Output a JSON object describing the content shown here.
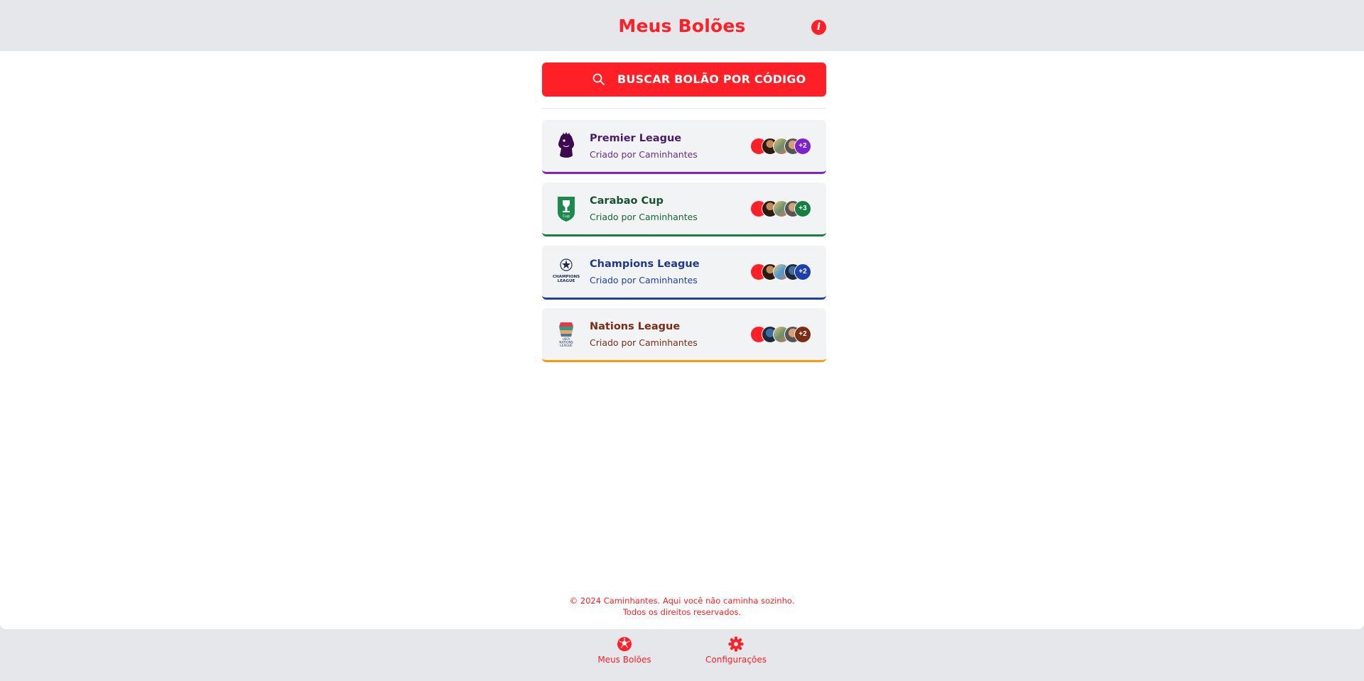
{
  "header": {
    "title": "Meus Bolões",
    "info_label": "i"
  },
  "search": {
    "label": "BUSCAR BOLÃO POR CÓDIGO"
  },
  "pools": [
    {
      "name": "Premier League",
      "creator": "Criado por Caminhantes",
      "color": "#4a1a6b",
      "accent": "#7e22ce",
      "extra": "+2",
      "logo": "premier-league-logo"
    },
    {
      "name": "Carabao Cup",
      "creator": "Criado por Caminhantes",
      "color": "#14532d",
      "accent": "#15803d",
      "extra": "+3",
      "logo": "carabao-cup-logo"
    },
    {
      "name": "Champions League",
      "creator": "Criado por Caminhantes",
      "color": "#1e3a8a",
      "accent": "#1e40af",
      "extra": "+2",
      "logo": "champions-league-logo"
    },
    {
      "name": "Nations League",
      "creator": "Criado por Caminhantes",
      "color": "#7c2d12",
      "accent": "#f59e0b",
      "extra": "+2",
      "logo": "nations-league-logo"
    }
  ],
  "footer": {
    "line1": "© 2024 Caminhantes. Aqui você não caminha sozinho.",
    "line2": "Todos os direitos reservados."
  },
  "nav": [
    {
      "label": "Meus Bolões",
      "icon": "soccer-ball-icon"
    },
    {
      "label": "Configurações",
      "icon": "gear-icon"
    }
  ],
  "colors": {
    "brand": "#ff1f26",
    "background": "#e5e7eb",
    "card": "#f1f3f5"
  }
}
